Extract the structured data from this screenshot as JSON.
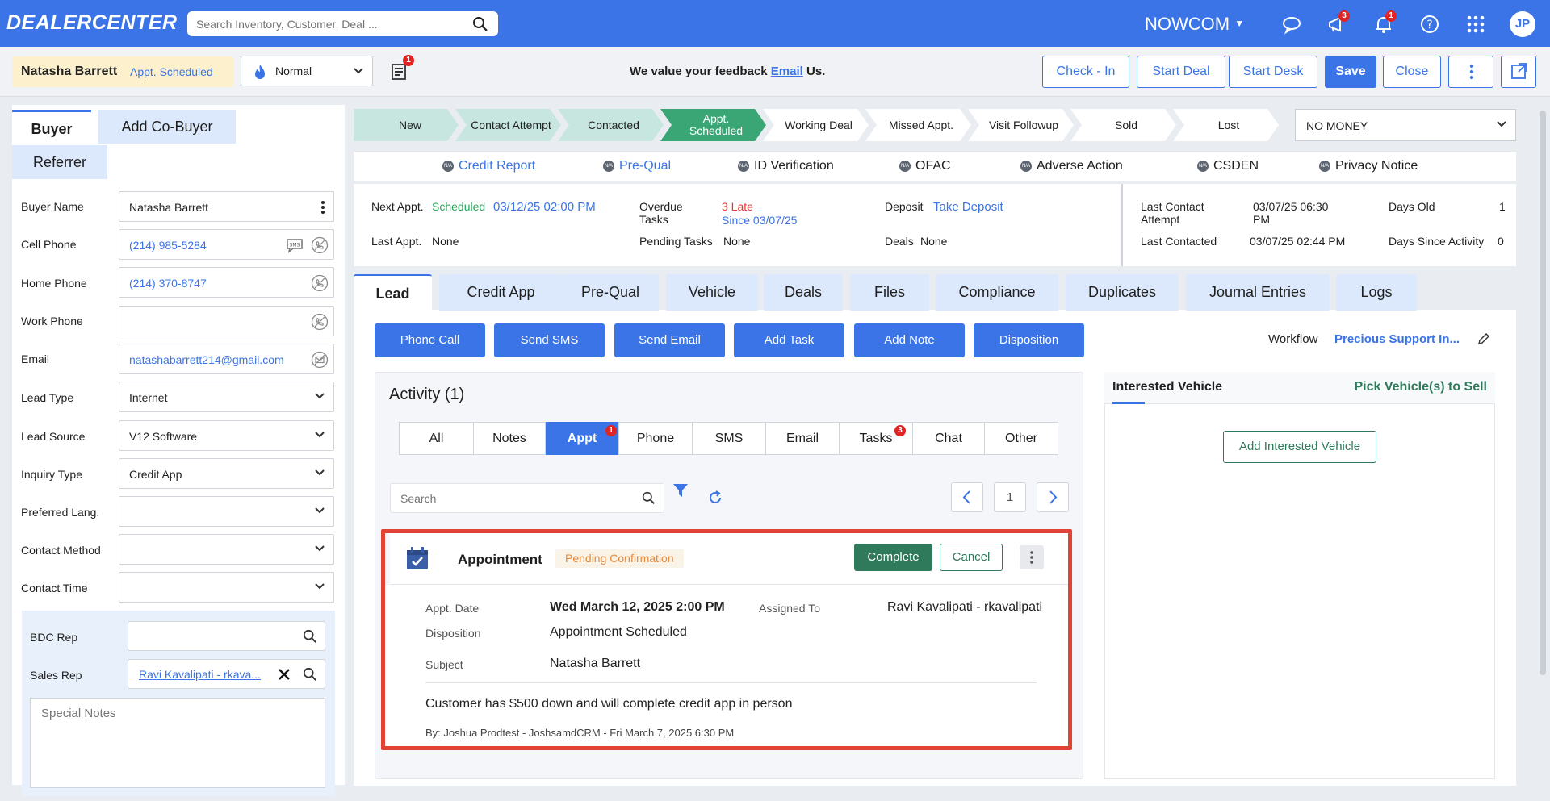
{
  "topbar": {
    "logo": "DEALERCENTER",
    "search_placeholder": "Search Inventory, Customer, Deal ...",
    "org": "NOWCOM",
    "messages_count": "3",
    "notifications_count": "1",
    "avatar": "JP",
    "brand_color": "#3a74e6"
  },
  "header": {
    "customer_name": "Natasha Barrett",
    "customer_status": "Appt. Scheduled",
    "priority": "Normal",
    "docs_badge": "1",
    "feedback_prefix": "We value your feedback",
    "feedback_link": "Email",
    "feedback_suffix": "Us.",
    "buttons": {
      "checkin": "Check - In",
      "start_deal": "Start Deal",
      "start_desk": "Start Desk",
      "save": "Save",
      "close": "Close"
    }
  },
  "left": {
    "tabs": {
      "buyer": "Buyer",
      "cobuyer": "Add Co-Buyer",
      "referrer": "Referrer"
    },
    "fields": {
      "buyer_name": {
        "label": "Buyer Name",
        "value": "Natasha Barrett"
      },
      "cell_phone": {
        "label": "Cell Phone",
        "value": "(214) 985-5284"
      },
      "home_phone": {
        "label": "Home Phone",
        "value": "(214) 370-8747"
      },
      "work_phone": {
        "label": "Work Phone",
        "value": ""
      },
      "email": {
        "label": "Email",
        "value": "natashabarrett214@gmail.com"
      },
      "lead_type": {
        "label": "Lead Type",
        "value": "Internet"
      },
      "lead_source": {
        "label": "Lead Source",
        "value": "V12 Software"
      },
      "inquiry_type": {
        "label": "Inquiry Type",
        "value": "Credit App"
      },
      "preferred_lang": {
        "label": "Preferred Lang.",
        "value": ""
      },
      "contact_method": {
        "label": "Contact Method",
        "value": ""
      },
      "contact_time": {
        "label": "Contact Time",
        "value": ""
      }
    },
    "bdc_rep_label": "BDC Rep",
    "sales_rep_label": "Sales Rep",
    "sales_rep_value": "Ravi Kavalipati - rkava...",
    "special_notes_placeholder": "Special Notes",
    "sms_tag": "SMS"
  },
  "stages": {
    "items": [
      "New",
      "Contact Attempt",
      "Contacted",
      "Appt. Scheduled",
      "Working Deal",
      "Missed Appt.",
      "Visit Followup",
      "Sold",
      "Lost"
    ],
    "dropdown": "NO MONEY"
  },
  "checks": {
    "na": "N/A",
    "items": [
      "Credit Report",
      "Pre-Qual",
      "ID Verification",
      "OFAC",
      "Adverse Action",
      "CSDEN",
      "Privacy Notice"
    ]
  },
  "info": {
    "next_appt_label": "Next Appt.",
    "next_appt_status": "Scheduled",
    "next_appt_value": "03/12/25 02:00 PM",
    "last_appt_label": "Last Appt.",
    "last_appt_value": "None",
    "overdue_label": "Overdue Tasks",
    "overdue_late": "3 Late",
    "overdue_since": "Since 03/07/25",
    "pending_label": "Pending Tasks",
    "pending_value": "None",
    "deposit_label": "Deposit",
    "deposit_value": "Take Deposit",
    "deals_label": "Deals",
    "deals_value": "None",
    "last_contact_attempt_label": "Last Contact Attempt",
    "last_contact_attempt_value": "03/07/25 06:30 PM",
    "last_contacted_label": "Last Contacted",
    "last_contacted_value": "03/07/25 02:44 PM",
    "days_old_label": "Days Old",
    "days_old_value": "1",
    "days_since_label": "Days Since Activity",
    "days_since_value": "0"
  },
  "tabs": [
    "Lead",
    "Credit App",
    "Pre-Qual",
    "Vehicle",
    "Deals",
    "Files",
    "Compliance",
    "Duplicates",
    "Journal Entries",
    "Logs"
  ],
  "actions": [
    "Phone Call",
    "Send SMS",
    "Send Email",
    "Add Task",
    "Add Note",
    "Disposition"
  ],
  "workflow": {
    "label": "Workflow",
    "value": "Precious Support In..."
  },
  "activity": {
    "title": "Activity (1)",
    "filters": [
      "All",
      "Notes",
      "Appt",
      "Phone",
      "SMS",
      "Email",
      "Tasks",
      "Chat",
      "Other"
    ],
    "appt_badge": "1",
    "tasks_badge": "3",
    "search_placeholder": "Search",
    "page": "1"
  },
  "appointment": {
    "title": "Appointment",
    "status": "Pending Confirmation",
    "complete": "Complete",
    "cancel": "Cancel",
    "date_label": "Appt. Date",
    "date_value": "Wed March 12, 2025 2:00 PM",
    "assigned_label": "Assigned To",
    "assigned_value": "Ravi Kavalipati - rkavalipati",
    "disposition_label": "Disposition",
    "disposition_value": "Appointment Scheduled",
    "subject_label": "Subject",
    "subject_value": "Natasha Barrett",
    "note": "Customer has $500 down and will complete credit app in person",
    "by": "By: Joshua Prodtest - JoshsamdCRM - Fri March 7, 2025 6:30 PM"
  },
  "interested": {
    "title": "Interested Vehicle",
    "pick": "Pick Vehicle(s) to Sell",
    "add": "Add Interested Vehicle"
  }
}
